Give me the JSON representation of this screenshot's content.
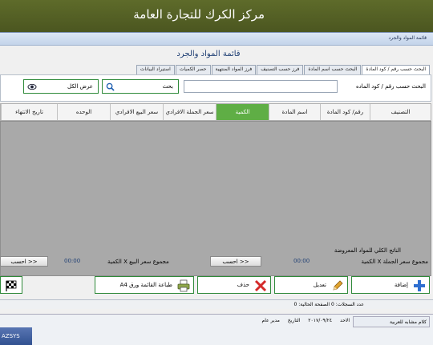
{
  "banner": {
    "title": "مركز الكرك للتجارة العامة"
  },
  "window": {
    "title": "قائمة المواد والجرد"
  },
  "form_title": "قائمة المواد والجرد",
  "tabs": [
    {
      "label": "البحث حسب رقم / كود المادة",
      "active": true
    },
    {
      "label": "البحث حسب اسم المادة",
      "active": false
    },
    {
      "label": "فرز حسب التصنيف",
      "active": false
    },
    {
      "label": "فرز المواد المنتهية",
      "active": false
    },
    {
      "label": "حصر الكميات",
      "active": false
    },
    {
      "label": "استيراد البيانات",
      "active": false
    }
  ],
  "search": {
    "label": "البحث حسب رقم / كود الماده",
    "value": "",
    "search_button": "بحث",
    "show_all_button": "عرض الكل"
  },
  "grid": {
    "columns": [
      {
        "label": "التصنيف",
        "active": false
      },
      {
        "label": "رقم/ كود المادة",
        "active": false
      },
      {
        "label": "اسم المادة",
        "active": false
      },
      {
        "label": "الكمية",
        "active": true
      },
      {
        "label": "سعر الجملة الافرادي",
        "active": false
      },
      {
        "label": "سعر البيع الافرادي",
        "active": false
      },
      {
        "label": "الوحده",
        "active": false
      },
      {
        "label": "تاريخ الانتهاء",
        "active": false
      }
    ],
    "rows": []
  },
  "totals": {
    "total_label": "الناتج الكلي للمواد المعروضة",
    "wholesale_label": "مجموع سعر الجملة X الكمية",
    "wholesale_value": "00:00",
    "wholesale_calc_button": "<< احسب",
    "sale_label": "مجموع سعر البيع X الكمية",
    "sale_value": "00:00",
    "sale_calc_button": "<< احسب"
  },
  "actions": {
    "add": "إضافة",
    "edit": "تعديل",
    "delete": "حذف",
    "print": "طباعة القائمة ورق A4"
  },
  "status": {
    "text": "عدد السجلات: 0   الصفحة الحالية: 0"
  },
  "taskbar": {
    "app_button": "AZSYS",
    "user": "مدير عام",
    "date_label": "التاريخ",
    "date": "٢٠١٧/٠٩/٢٤",
    "day": "الاحد",
    "ext_window": "كلام مشابه للعربية"
  },
  "colors": {
    "banner": "#566325",
    "accent_green": "#5fae45",
    "grid_body": "#a9a9a9"
  }
}
